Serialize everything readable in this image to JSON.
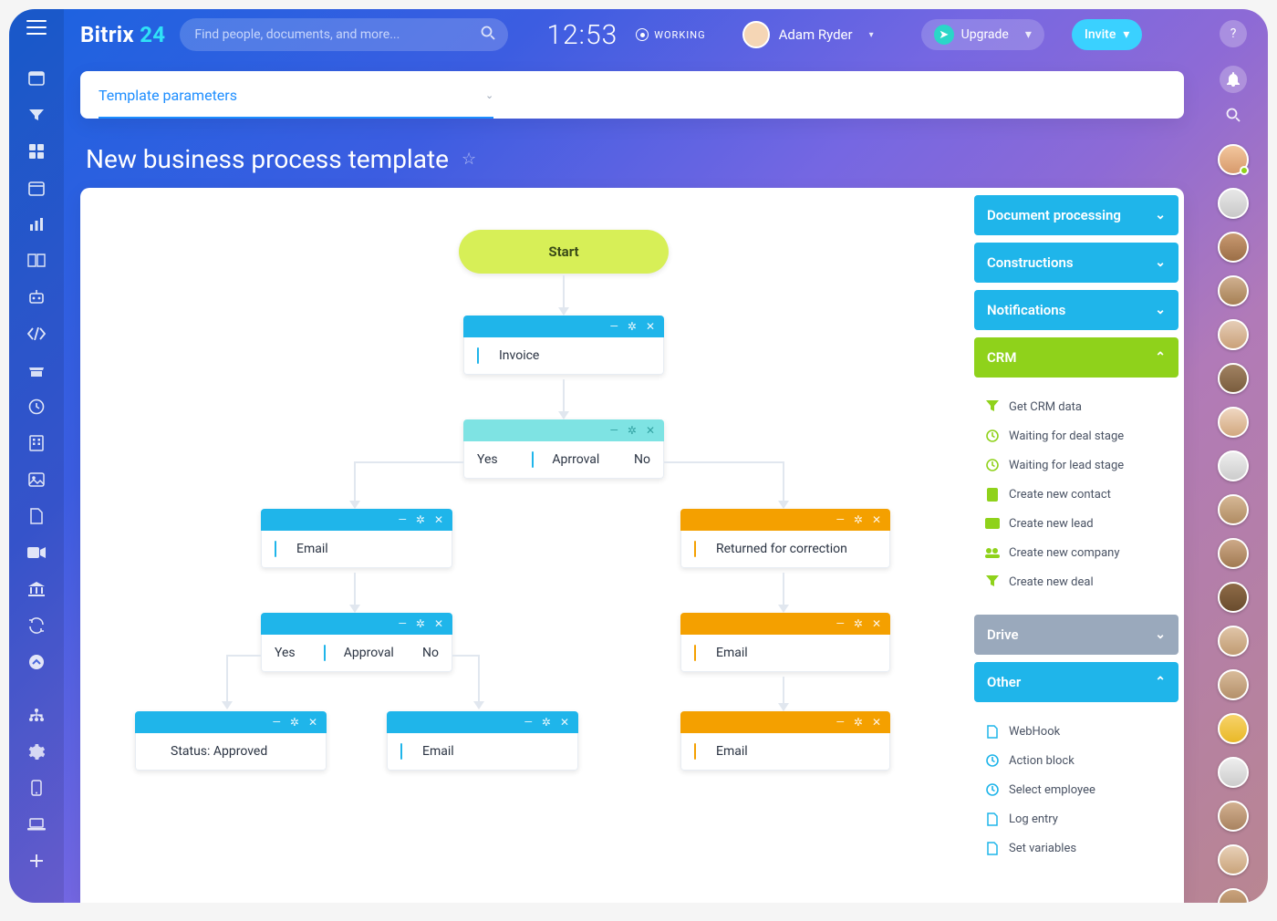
{
  "brand": {
    "part1": "Bitrix",
    "part2": "24"
  },
  "search": {
    "placeholder": "Find people, documents, and more..."
  },
  "clock": "12:53",
  "working_label": "WORKING",
  "user": {
    "name": "Adam Ryder"
  },
  "upgrade_label": "Upgrade",
  "invite_label": "Invite",
  "tabbar": {
    "active_tab": "Template parameters"
  },
  "page_title": "New business process template",
  "left_rail_icons": [
    "menu-icon",
    "feed-icon",
    "filter-icon",
    "apps-icon",
    "calendar-icon",
    "chart-icon",
    "book-icon",
    "robot-icon",
    "code-icon",
    "store-icon",
    "clock-icon",
    "building-icon",
    "image-icon",
    "page-icon",
    "video-icon",
    "bank-icon",
    "recycle-icon",
    "up-icon",
    "tree-icon",
    "gear-icon",
    "mobile-icon",
    "laptop-icon",
    "plus-icon"
  ],
  "flow": {
    "start_label": "Start",
    "invoice_label": "Invoice",
    "approval1_label": "Aprroval",
    "approval1_yes": "Yes",
    "approval1_no": "No",
    "email_left_label": "Email",
    "returned_label": "Returned for correction",
    "approval2_label": "Approval",
    "approval2_yes": "Yes",
    "approval2_no": "No",
    "status_approved_label": "Status: Approved",
    "email_bl_label": "Email",
    "email_r1_label": "Email",
    "email_r2_label": "Email"
  },
  "palette": {
    "doc_processing": "Document processing",
    "constructions": "Constructions",
    "notifications": "Notifications",
    "crm": "CRM",
    "crm_items": [
      "Get CRM data",
      "Waiting for deal stage",
      "Waiting for lead stage",
      "Create new contact",
      "Create new lead",
      "Create new company",
      "Create new deal"
    ],
    "drive": "Drive",
    "other": "Other",
    "other_items": [
      "WebHook",
      "Action block",
      "Select employee",
      "Log entry",
      "Set variables"
    ]
  },
  "contact_avatars_count": 18
}
